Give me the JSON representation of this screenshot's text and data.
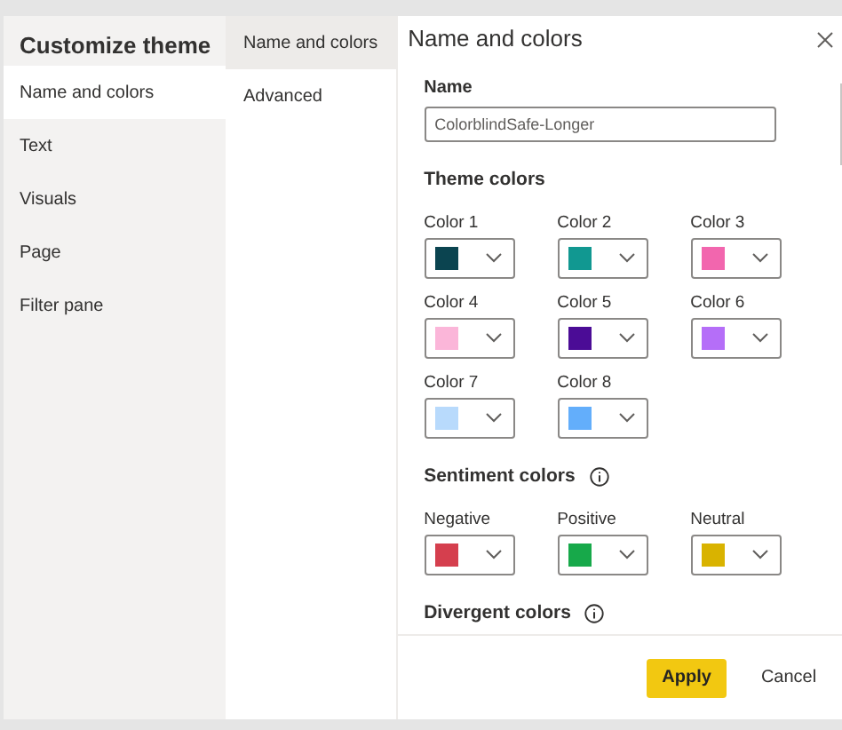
{
  "sidebar": {
    "title": "Customize theme",
    "items": [
      {
        "label": "Name and colors",
        "selected": true
      },
      {
        "label": "Text",
        "selected": false
      },
      {
        "label": "Visuals",
        "selected": false
      },
      {
        "label": "Page",
        "selected": false
      },
      {
        "label": "Filter pane",
        "selected": false
      }
    ]
  },
  "subnav": {
    "items": [
      {
        "label": "Name and colors",
        "selected": true
      },
      {
        "label": "Advanced",
        "selected": false
      }
    ]
  },
  "panel": {
    "title": "Name and colors",
    "name_label": "Name",
    "name_value": "ColorblindSafe-Longer",
    "sections": [
      {
        "title": "Theme colors",
        "info": false,
        "colors": [
          {
            "label": "Color 1",
            "color": "#0b4450"
          },
          {
            "label": "Color 2",
            "color": "#119891"
          },
          {
            "label": "Color 3",
            "color": "#f266ae"
          },
          {
            "label": "Color 4",
            "color": "#fbb6d9"
          },
          {
            "label": "Color 5",
            "color": "#4b0c96"
          },
          {
            "label": "Color 6",
            "color": "#b56ef8"
          },
          {
            "label": "Color 7",
            "color": "#b8dafc"
          },
          {
            "label": "Color 8",
            "color": "#63aefb"
          }
        ]
      },
      {
        "title": "Sentiment colors",
        "info": true,
        "colors": [
          {
            "label": "Negative",
            "color": "#d53f4e"
          },
          {
            "label": "Positive",
            "color": "#17a94a"
          },
          {
            "label": "Neutral",
            "color": "#d9b300"
          }
        ]
      },
      {
        "title": "Divergent colors",
        "info": true
      }
    ]
  },
  "buttons": {
    "apply": "Apply",
    "cancel": "Cancel"
  }
}
